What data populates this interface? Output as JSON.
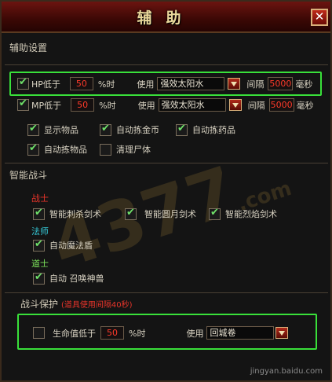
{
  "window": {
    "title": "辅助",
    "close_icon": "close-icon"
  },
  "assist": {
    "header": "辅助设置",
    "hp": {
      "checked": true,
      "label": "HP低于",
      "value": "50",
      "unit": "%时",
      "use_label": "使用",
      "item": "强效太阳水",
      "interval_label": "间隔",
      "interval": "5000",
      "ms": "毫秒"
    },
    "mp": {
      "checked": true,
      "label": "MP低于",
      "value": "50",
      "unit": "%时",
      "use_label": "使用",
      "item": "强效太阳水",
      "interval_label": "间隔",
      "interval": "5000",
      "ms": "毫秒"
    },
    "options": [
      {
        "label": "显示物品",
        "checked": true
      },
      {
        "label": "自动拣金币",
        "checked": true
      },
      {
        "label": "自动拣药品",
        "checked": true
      },
      {
        "label": "自动拣物品",
        "checked": true
      },
      {
        "label": "清理尸体",
        "checked": false
      }
    ]
  },
  "combat": {
    "header": "智能战斗",
    "warrior": {
      "label": "战士",
      "skills": [
        {
          "label": "智能刺杀剑术",
          "checked": true
        },
        {
          "label": "智能圆月剑术",
          "checked": true
        },
        {
          "label": "智能烈焰剑术",
          "checked": true
        }
      ]
    },
    "mage": {
      "label": "法师",
      "skills": [
        {
          "label": "自动魔法盾",
          "checked": true
        }
      ]
    },
    "taoist": {
      "label": "道士",
      "skills": [
        {
          "label": "自动 召唤神兽",
          "checked": true
        }
      ]
    }
  },
  "protect": {
    "header": "战斗保护",
    "note": "(道具使用间隔40秒)",
    "life": {
      "checked": false,
      "label": "生命值低于",
      "value": "50",
      "unit": "%时",
      "use_label": "使用",
      "item": "回城卷"
    }
  },
  "watermark": {
    "big": "4377",
    "small": ".com",
    "footer": "jingyan.baidu.com"
  },
  "colors": {
    "highlight": "#39e03a",
    "value_red": "#ff3a2a",
    "warrior": "#e8342a",
    "mage": "#35c8d6",
    "taoist": "#7be05a"
  }
}
